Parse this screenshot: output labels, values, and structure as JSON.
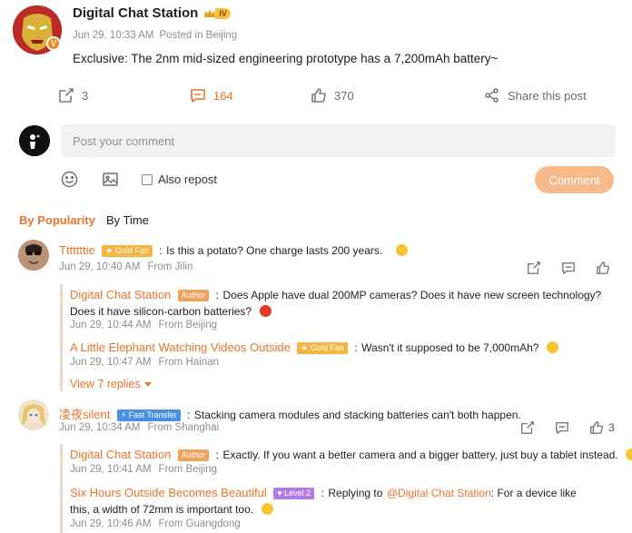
{
  "post": {
    "author": "Digital Chat Station",
    "level_badge": "IV",
    "verified_mark": "V",
    "date": "Jun 29, 10:33 AM",
    "location": "Posted in Beijing",
    "content": "Exclusive: The 2nm mid-sized engineering prototype has a 7,200mAh battery~",
    "repost_count": "3",
    "comment_count": "164",
    "like_count": "370",
    "share_label": "Share this post"
  },
  "composer": {
    "placeholder": "Post your comment",
    "also_repost_label": "Also repost",
    "submit_label": "Comment"
  },
  "sort_tabs": {
    "popularity": "By Popularity",
    "time": "By Time"
  },
  "comments": [
    {
      "author": "Tttttttie",
      "badge": "Gold Fan",
      "separator": ":",
      "text": "Is this a potato? One charge lasts 200 years.",
      "date": "Jun 29, 10:40 AM",
      "location": "From Jilin",
      "replies": [
        {
          "author": "Digital Chat Station",
          "badge": "Author",
          "separator": ":",
          "text": "Does Apple have dual 200MP cameras? Does it have new screen technology? Does it have silicon-carbon batteries?",
          "date": "Jun 29, 10:44 AM",
          "location": "From Beijing"
        },
        {
          "author": "A Little Elephant Watching Videos Outside",
          "badge": "Gold Fan",
          "separator": ":",
          "text": "Wasn't it supposed to be 7,000mAh?",
          "date": "Jun 29, 10:47 AM",
          "location": "From Hainan"
        }
      ],
      "view_replies": "View 7 replies"
    },
    {
      "author": "凌夜silent",
      "badge": "Fast Transfer",
      "separator": ":",
      "text": "Stacking camera modules and stacking batteries can't both happen.",
      "date": "Jun 29, 10:34 AM",
      "location": "From Shanghai",
      "like_count": "3",
      "replies": [
        {
          "author": "Digital Chat Station",
          "badge": "Author",
          "separator": ":",
          "text": "Exactly. If you want a better camera and a bigger battery, just buy a tablet instead.",
          "date": "Jun 29, 10:41 AM",
          "location": "From Beijing"
        },
        {
          "author": "Six Hours Outside Becomes Beautiful",
          "badge": "Level 2",
          "separator": ":",
          "text_prefix": "Replying to",
          "mention": "@Digital Chat Station",
          "text": ": For a device like this, a width of 72mm is important too.",
          "date": "Jun 29, 10:46 AM",
          "location": "From Guangdong"
        }
      ]
    }
  ],
  "colors": {
    "accent": "#e8732b",
    "button_bg": "#f6b98a",
    "input_bg": "#f2f2f2"
  },
  "icons": [
    "repost-icon",
    "comment-icon",
    "like-icon",
    "share-icon",
    "emoji-icon",
    "image-icon",
    "chevron-down-icon"
  ]
}
